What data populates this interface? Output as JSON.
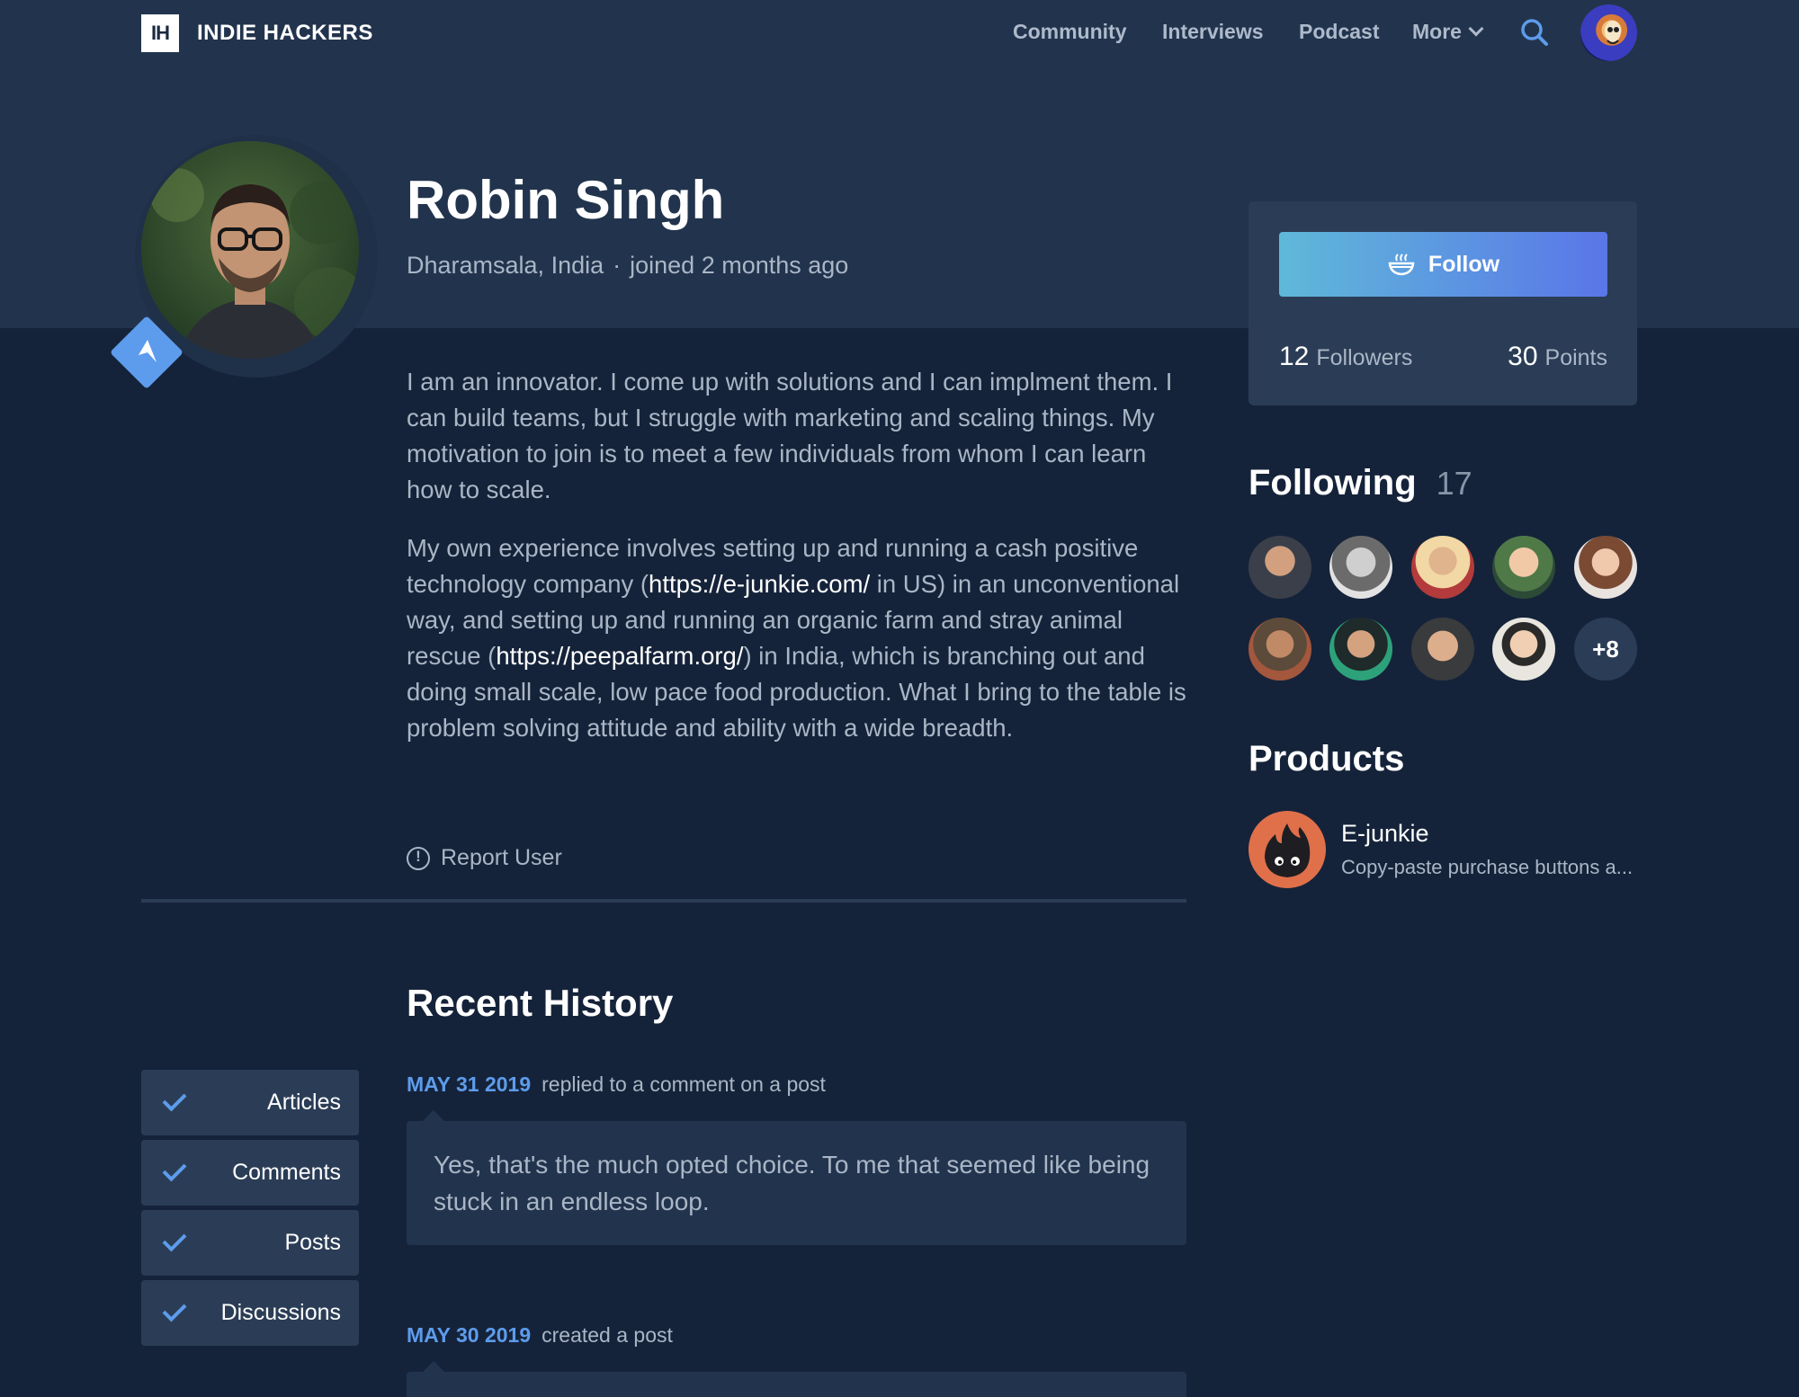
{
  "header": {
    "logo_mark": "IH",
    "logo_text": "INDIE HACKERS",
    "nav": [
      {
        "label": "Community"
      },
      {
        "label": "Interviews"
      },
      {
        "label": "Podcast"
      },
      {
        "label": "More"
      }
    ],
    "icons": {
      "search": "search-icon",
      "avatar": "user-avatar"
    }
  },
  "profile": {
    "name": "Robin Singh",
    "location": "Dharamsala, India",
    "separator": "·",
    "joined": "joined 2 months ago",
    "bio": {
      "p1": "I am an innovator. I come up with solutions and I can implment them. I can build teams, but I struggle with marketing and scaling things. My motivation to join is to meet a few individuals from whom I can learn how to scale.",
      "p2_a": "My own experience involves setting up and running a cash positive technology company (",
      "p2_link1": "https://e-junkie.com/",
      "p2_b": " in US) in an unconventional way, and setting up and running an organic farm and stray animal rescue (",
      "p2_link2": "https://peepalfarm.org/",
      "p2_c": ") in India, which is branching out and doing small scale, low pace food production. What I bring to the table is problem solving attitude and ability with a wide breadth."
    },
    "report_label": "Report User"
  },
  "sidebar": {
    "follow_label": "Follow",
    "followers_count": "12",
    "followers_label": "Followers",
    "points_count": "30",
    "points_label": "Points",
    "following_title": "Following",
    "following_count": "17",
    "following_more": "+8",
    "products_title": "Products",
    "product": {
      "name": "E-junkie",
      "desc": "Copy-paste purchase buttons a..."
    }
  },
  "history": {
    "title": "Recent History",
    "filters": [
      {
        "label": "Articles",
        "checked": true
      },
      {
        "label": "Comments",
        "checked": true
      },
      {
        "label": "Posts",
        "checked": true
      },
      {
        "label": "Discussions",
        "checked": true
      }
    ],
    "items": [
      {
        "date": "MAY 31 2019",
        "action": "replied to a comment on a post",
        "text": "Yes, that's the much opted choice. To me that seemed like being stuck in an endless loop."
      },
      {
        "date": "MAY 30 2019",
        "action": "created a post",
        "text": ""
      }
    ]
  },
  "colors": {
    "accent": "#5d9cec",
    "background": "#15233a",
    "band": "#22344d"
  }
}
